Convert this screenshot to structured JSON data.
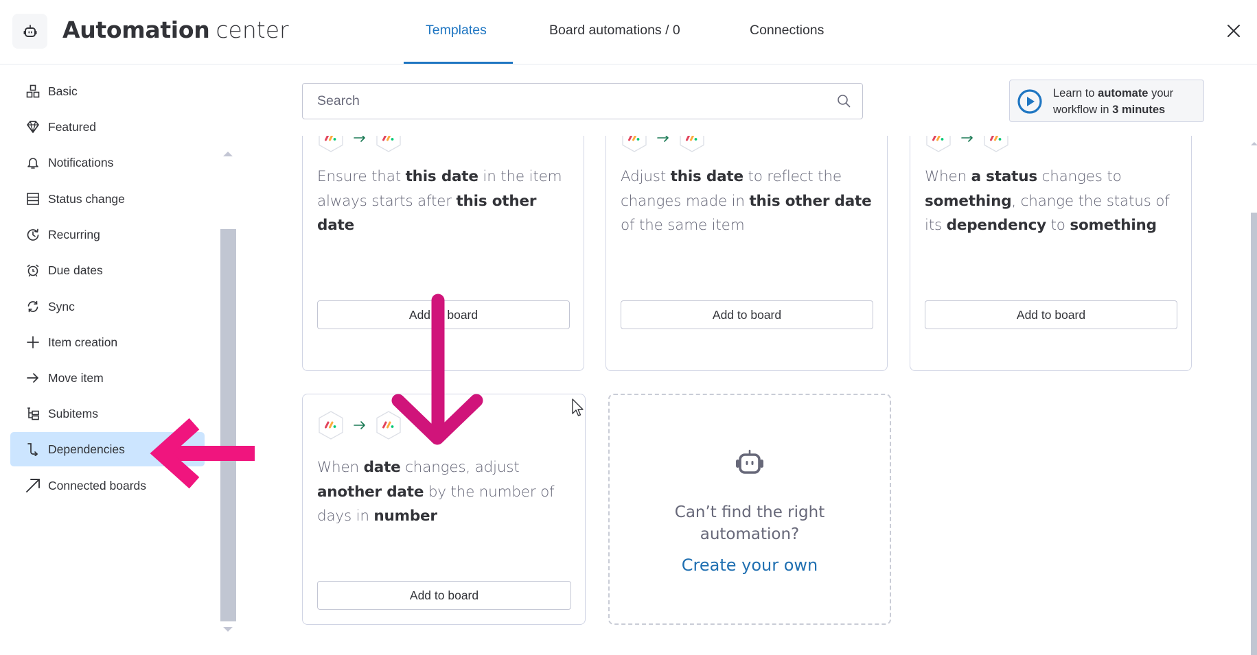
{
  "header": {
    "title_bold": "Automation",
    "title_light": "center",
    "logo_icon": "robot-icon",
    "close_icon": "close-icon"
  },
  "tabs": [
    {
      "label": "Templates",
      "active": true
    },
    {
      "label": "Board automations / 0",
      "active": false
    },
    {
      "label": "Connections",
      "active": false
    }
  ],
  "sidebar": {
    "selected": "Dependencies",
    "items": [
      {
        "label": "Basic",
        "icon": "blocks-icon"
      },
      {
        "label": "Featured",
        "icon": "diamond-icon"
      },
      {
        "label": "Notifications",
        "icon": "bell-icon"
      },
      {
        "label": "Status change",
        "icon": "status-rows-icon"
      },
      {
        "label": "Recurring",
        "icon": "recurring-icon"
      },
      {
        "label": "Due dates",
        "icon": "alarm-clock-icon"
      },
      {
        "label": "Sync",
        "icon": "sync-icon"
      },
      {
        "label": "Item creation",
        "icon": "plus-icon"
      },
      {
        "label": "Move item",
        "icon": "arrow-right-icon"
      },
      {
        "label": "Subitems",
        "icon": "subitems-icon"
      },
      {
        "label": "Dependencies",
        "icon": "dependency-icon"
      },
      {
        "label": "Connected boards",
        "icon": "arrow-up-right-icon"
      }
    ]
  },
  "search": {
    "placeholder": "Search",
    "value": ""
  },
  "learn": {
    "pre": "Learn to ",
    "bold1": "automate",
    "mid": " your workflow in ",
    "bold2": "3 minutes"
  },
  "cards": [
    {
      "segments": [
        {
          "text": "Ensure that ",
          "bold": false
        },
        {
          "text": "this date",
          "bold": true
        },
        {
          "text": " in the item always starts after ",
          "bold": false
        },
        {
          "text": "this other date",
          "bold": true
        }
      ],
      "button": "Add to board"
    },
    {
      "segments": [
        {
          "text": "Adjust ",
          "bold": false
        },
        {
          "text": "this date",
          "bold": true
        },
        {
          "text": " to reflect the changes made in ",
          "bold": false
        },
        {
          "text": "this other date",
          "bold": true
        },
        {
          "text": " of the same item",
          "bold": false
        }
      ],
      "button": "Add to board"
    },
    {
      "segments": [
        {
          "text": "When ",
          "bold": false
        },
        {
          "text": "a status",
          "bold": true
        },
        {
          "text": " changes to ",
          "bold": false
        },
        {
          "text": "something",
          "bold": true
        },
        {
          "text": ", change the status of its ",
          "bold": false
        },
        {
          "text": "dependency",
          "bold": true
        },
        {
          "text": " to ",
          "bold": false
        },
        {
          "text": "something",
          "bold": true
        }
      ],
      "button": "Add to board"
    },
    {
      "segments": [
        {
          "text": "When ",
          "bold": false
        },
        {
          "text": "date",
          "bold": true
        },
        {
          "text": " changes, adjust ",
          "bold": false
        },
        {
          "text": "another date",
          "bold": true
        },
        {
          "text": " by the number of days in ",
          "bold": false
        },
        {
          "text": "number",
          "bold": true
        }
      ],
      "button": "Add to board"
    }
  ],
  "custom_card": {
    "question": "Can’t find the right automation?",
    "link": "Create your own",
    "icon": "robot-icon"
  },
  "colors": {
    "accent": "#1f76c2",
    "selected_bg": "#cce5ff",
    "annotation_pink": "#f0157e",
    "annotation_magenta": "#d0147a"
  }
}
